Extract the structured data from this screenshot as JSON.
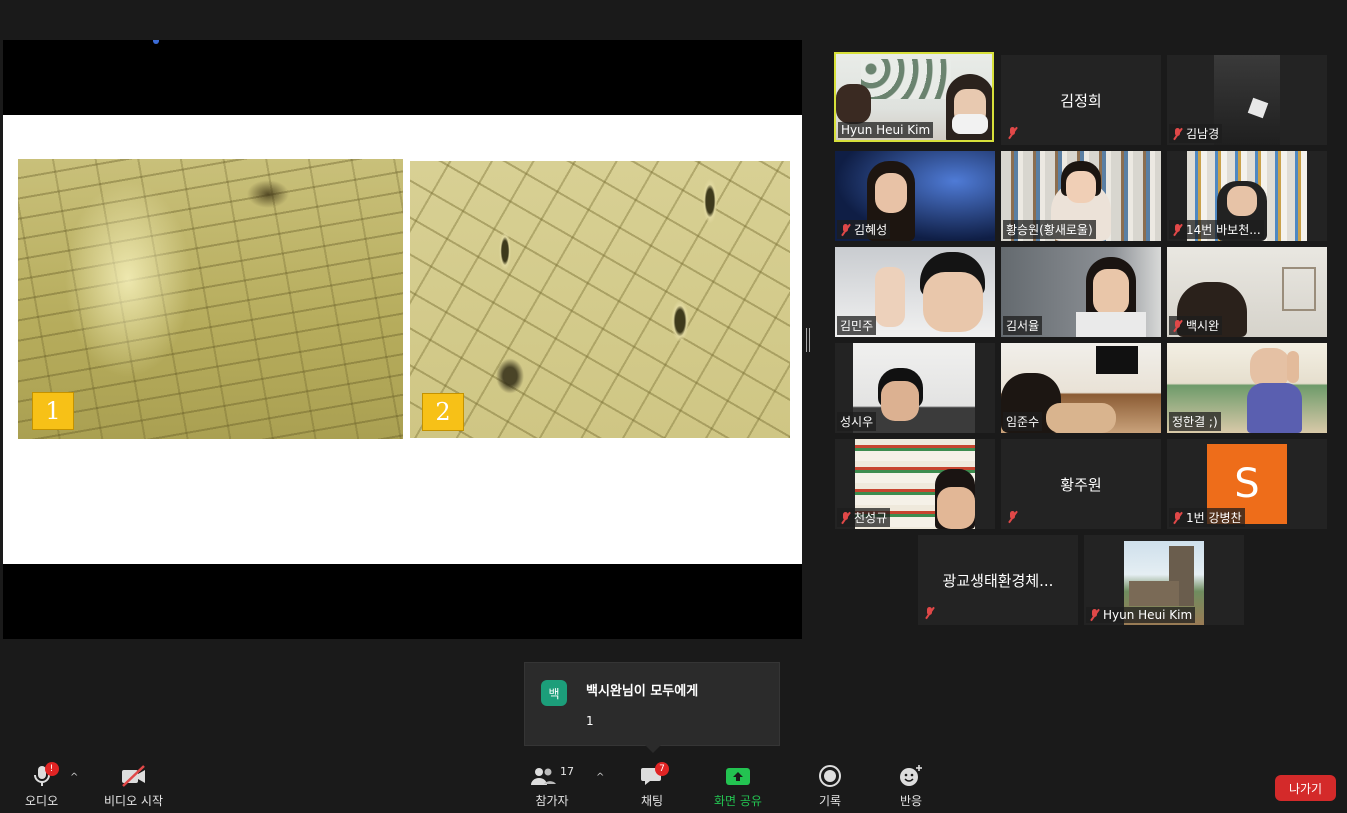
{
  "slide": {
    "image1_tag": "1",
    "image2_tag": "2"
  },
  "gallery": {
    "tiles": [
      {
        "name": "Hyun Heui Kim",
        "video": true,
        "muted": false,
        "active": true
      },
      {
        "name": "김정희",
        "video": false,
        "muted": true
      },
      {
        "name": "김남경",
        "video": true,
        "muted": true
      },
      {
        "name": "김혜성",
        "video": true,
        "muted": true
      },
      {
        "name": "황승원(황새로울)",
        "video": true,
        "muted": false
      },
      {
        "name": "14번 바보천...",
        "video": true,
        "muted": true
      },
      {
        "name": "김민주",
        "video": true,
        "muted": false
      },
      {
        "name": "김서율",
        "video": true,
        "muted": false
      },
      {
        "name": "백시완",
        "video": true,
        "muted": true
      },
      {
        "name": "성시우",
        "video": true,
        "muted": false
      },
      {
        "name": "임준수",
        "video": true,
        "muted": false
      },
      {
        "name": "정한결 ;)",
        "video": true,
        "muted": false
      },
      {
        "name": "천성규",
        "video": true,
        "muted": true
      },
      {
        "name": "황주원",
        "video": false,
        "muted": true
      },
      {
        "name": "1번 강병찬",
        "video": false,
        "avatar_letter": "S",
        "muted": true
      },
      {
        "name": "광교생태환경체...",
        "video": false,
        "muted": true
      },
      {
        "name": "Hyun Heui Kim",
        "video": true,
        "muted": true
      }
    ]
  },
  "chat_toast": {
    "avatar": "백",
    "from": "백시완님이 모두에게",
    "message": "1"
  },
  "toolbar": {
    "audio_label": "오디오",
    "video_label": "비디오 시작",
    "participants_label": "참가자",
    "participants_count": "17",
    "chat_label": "채팅",
    "chat_badge": "7",
    "share_label": "화면 공유",
    "record_label": "기록",
    "reactions_label": "반응",
    "leave_label": "나가기",
    "audio_alert": "!"
  },
  "colors": {
    "active_speaker_border": "#d7e03a",
    "share_green": "#23c351",
    "leave_red": "#d42a2a",
    "mute_red": "#e04848"
  }
}
